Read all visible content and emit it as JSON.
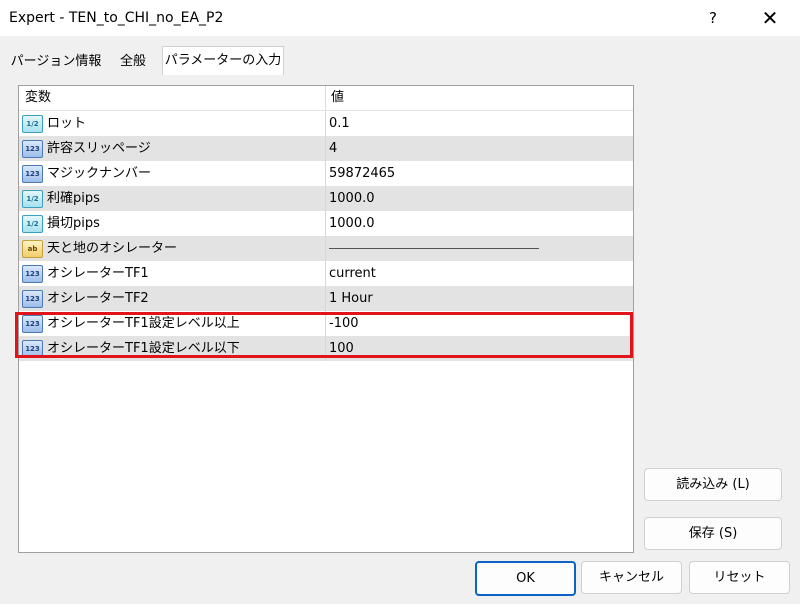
{
  "window": {
    "title": "Expert - TEN_to_CHI_no_EA_P2",
    "help_label": "?",
    "close_label": "✕"
  },
  "tabs": [
    {
      "label": "パージョン情報"
    },
    {
      "label": "全般"
    },
    {
      "label": "パラメーターの入力",
      "active": true
    }
  ],
  "grid": {
    "header": {
      "name": "変数",
      "value": "値"
    },
    "rows": [
      {
        "icon": "1/2",
        "type": "double",
        "name": "ロット",
        "value": "0.1"
      },
      {
        "icon": "123",
        "type": "int",
        "name": "許容スリッページ",
        "value": "4"
      },
      {
        "icon": "123",
        "type": "int",
        "name": "マジックナンバー",
        "value": "59872465"
      },
      {
        "icon": "1/2",
        "type": "double",
        "name": "利確pips",
        "value": "1000.0"
      },
      {
        "icon": "1/2",
        "type": "double",
        "name": "損切pips",
        "value": "1000.0"
      },
      {
        "icon": "ab",
        "type": "string",
        "name": "天と地のオシレーター",
        "value": ""
      },
      {
        "icon": "123",
        "type": "int",
        "name": "オシレーターTF1",
        "value": "current"
      },
      {
        "icon": "123",
        "type": "int",
        "name": "オシレーターTF2",
        "value": "1 Hour"
      },
      {
        "icon": "123",
        "type": "int",
        "name": "オシレーターTF1設定レベル以上",
        "value": "-100"
      },
      {
        "icon": "123",
        "type": "int",
        "name": "オシレーターTF1設定レベル以下",
        "value": "100"
      }
    ]
  },
  "buttons": {
    "load": "読み込み (L)",
    "save": "保存 (S)",
    "ok": "OK",
    "cancel": "キャンセル",
    "reset": "リセット"
  },
  "colors": {
    "highlight": "#e0141a",
    "ok_border": "#0b63c8"
  }
}
